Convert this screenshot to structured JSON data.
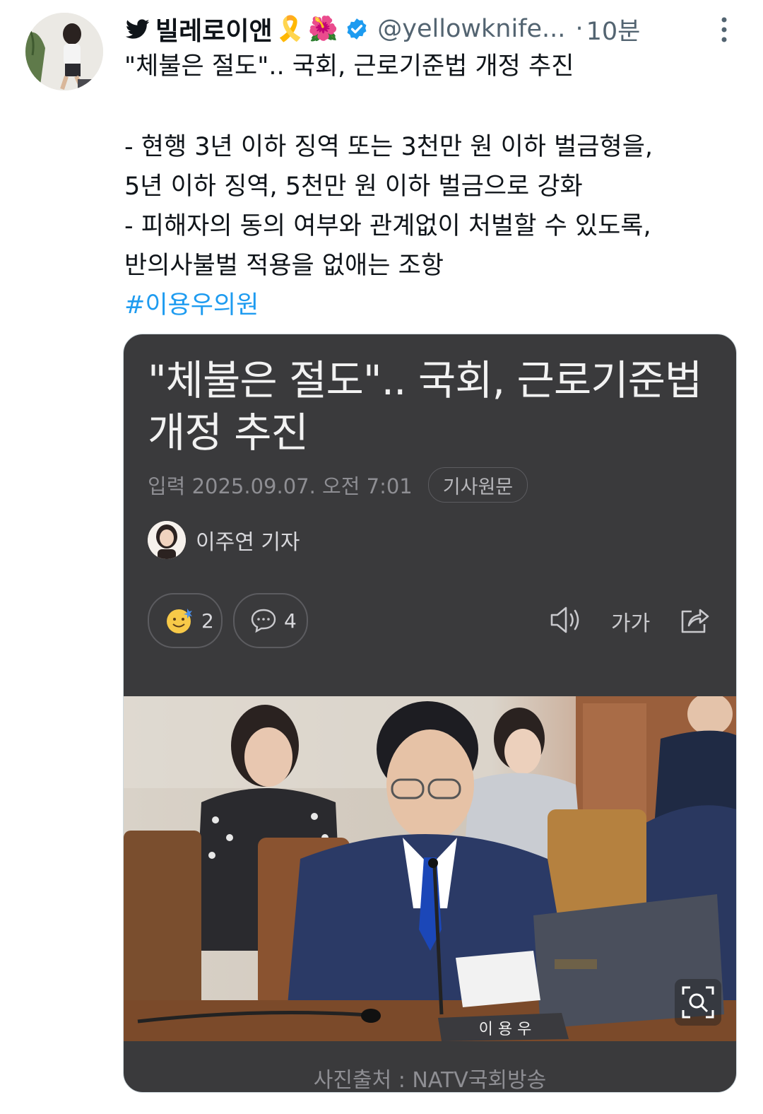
{
  "user": {
    "display_name": "빌레로이앤",
    "emojis": [
      "🎗️",
      "🌺"
    ],
    "handle": "@yellowknife...",
    "dot": "·",
    "time": "10분",
    "verified": true,
    "icons": [
      "twitter-bird-icon",
      "verified-badge-icon",
      "more-options-icon"
    ]
  },
  "tweet": {
    "line1": "\"체불은 절도\".. 국회, 근로기준법 개정 추진",
    "line2": "- 현행 3년 이하 징역 또는 3천만 원 이하 벌금형을,",
    "line3": "5년 이하 징역, 5천만 원 이하 벌금으로 강화",
    "line4": "- 피해자의 동의 여부와 관계없이 처벌할 수 있도록,",
    "line5": "반의사불벌 적용을 없애는 조항",
    "hashtag": "#이용우의원"
  },
  "card": {
    "title_line1": "\"체불은 절도\".. 국회, 근로기준법",
    "title_line2": "개정 추진",
    "date": "입력 2025.09.07. 오전 7:01",
    "original_button": "기사원문",
    "reporter": "이주연 기자",
    "reaction_count": "2",
    "comment_count": "4",
    "font_size_label": "가가",
    "nameplate": "이 용 우",
    "photo_credit": "사진출처 : NATV국회방송",
    "icons": [
      "smile-emoji-icon",
      "comment-icon",
      "speaker-icon",
      "font-size-icon",
      "share-icon",
      "zoom-icon"
    ]
  },
  "colors": {
    "link": "#1d9bf0",
    "verified": "#1d9bf0",
    "card_bg": "#3a3a3c"
  }
}
